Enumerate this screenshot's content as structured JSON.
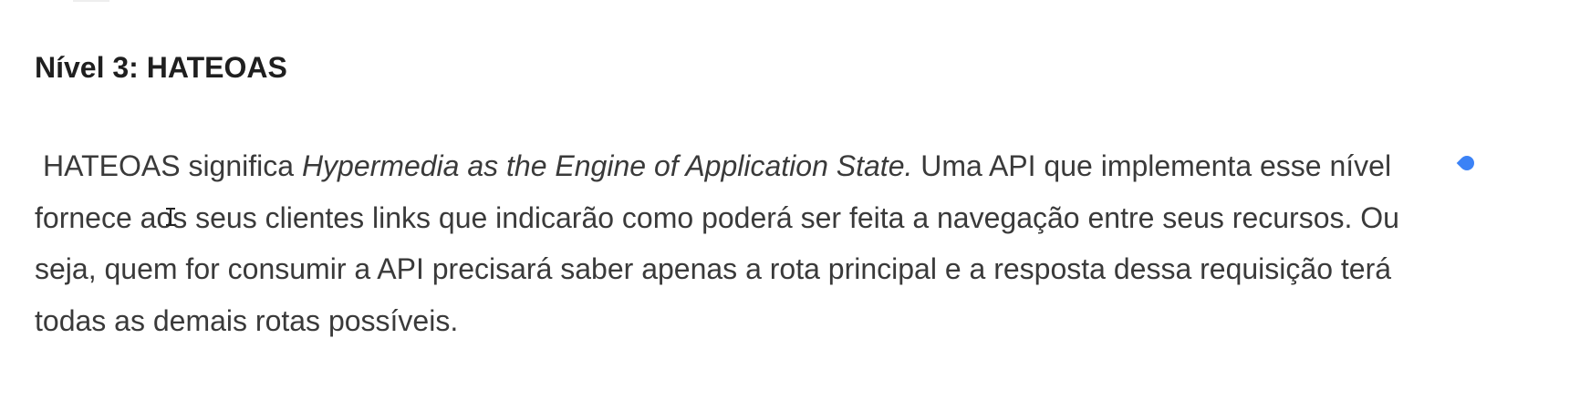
{
  "heading": "Nível 3: HATEOAS",
  "paragraph": {
    "part1": "HATEOAS significa ",
    "italic": "Hypermedia as the Engine of Application State.",
    "part2": " Uma API que implementa esse nível fornece aos seus clientes links que indicarão como poderá ser feita a navegação entre seus recursos. Ou seja, quem for consumir a API precisará saber apenas a rota principal e a resposta dessa requisição terá todas as demais rotas possíveis."
  },
  "icons": {
    "cursor_dot": "cursor-dot-icon",
    "text_cursor": "text-cursor-icon"
  },
  "colors": {
    "cursor_dot": "#3b82f6",
    "heading": "#1f1f1f",
    "body_text": "#3a3a3a"
  }
}
